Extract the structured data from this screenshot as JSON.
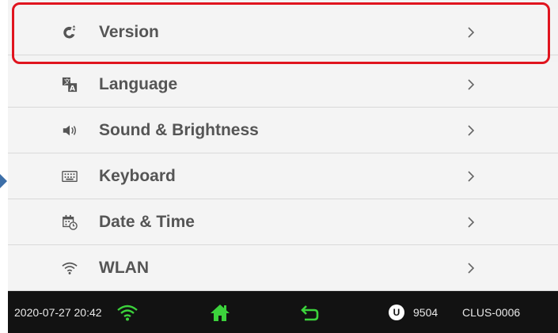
{
  "menu": {
    "items": [
      {
        "label": "Version",
        "icon": "version-icon"
      },
      {
        "label": "Language",
        "icon": "language-icon"
      },
      {
        "label": "Sound & Brightness",
        "icon": "speaker-icon"
      },
      {
        "label": "Keyboard",
        "icon": "keyboard-icon"
      },
      {
        "label": "Date & Time",
        "icon": "calendar-clock-icon"
      },
      {
        "label": "WLAN",
        "icon": "wifi-icon"
      }
    ],
    "chevron": "chevron-right-icon",
    "highlighted": "Version"
  },
  "status_bar": {
    "datetime": "2020-07-27 20:42",
    "wifi_icon": "wifi-icon",
    "home_icon": "home-icon",
    "back_icon": "back-icon",
    "user_badge": "U",
    "user_number": "9504",
    "device_id": "CLUS-0006"
  },
  "colors": {
    "highlight": "#e0141e",
    "status_accent": "#3cd23c",
    "menu_text": "#555555",
    "status_background": "#121212"
  }
}
